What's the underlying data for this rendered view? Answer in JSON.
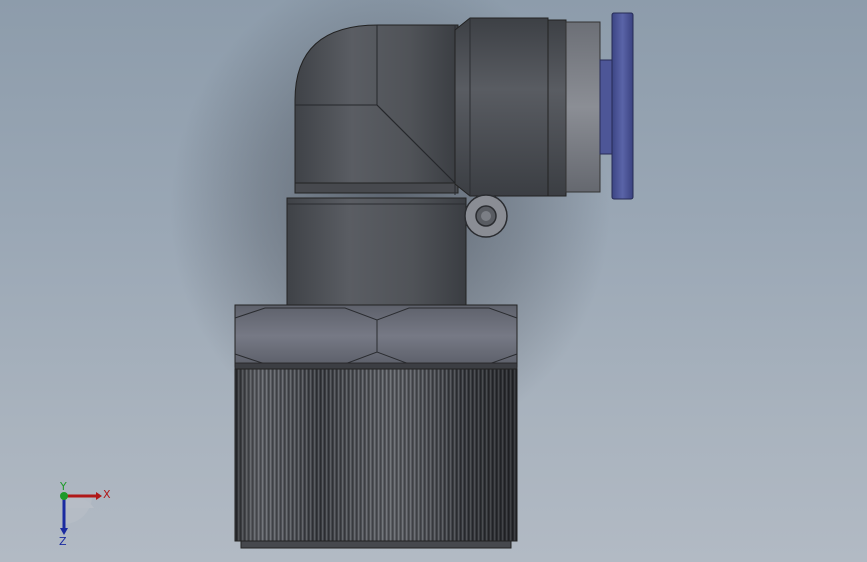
{
  "viewport": {
    "background_top": "#8d9cab",
    "background_bottom": "#b2bac4"
  },
  "model": {
    "body_color": "#505358",
    "nut_color": "#6b6e78",
    "collar_color": "#7d7f86",
    "release_ring_color": "#4f5a9c",
    "knurl_color": "#3e4045"
  },
  "triad": {
    "x_label": "X",
    "y_label": "Y",
    "z_label": "Z",
    "x_color": "#b01818",
    "y_color": "#1f9a2a",
    "z_color": "#1a2aa0"
  }
}
